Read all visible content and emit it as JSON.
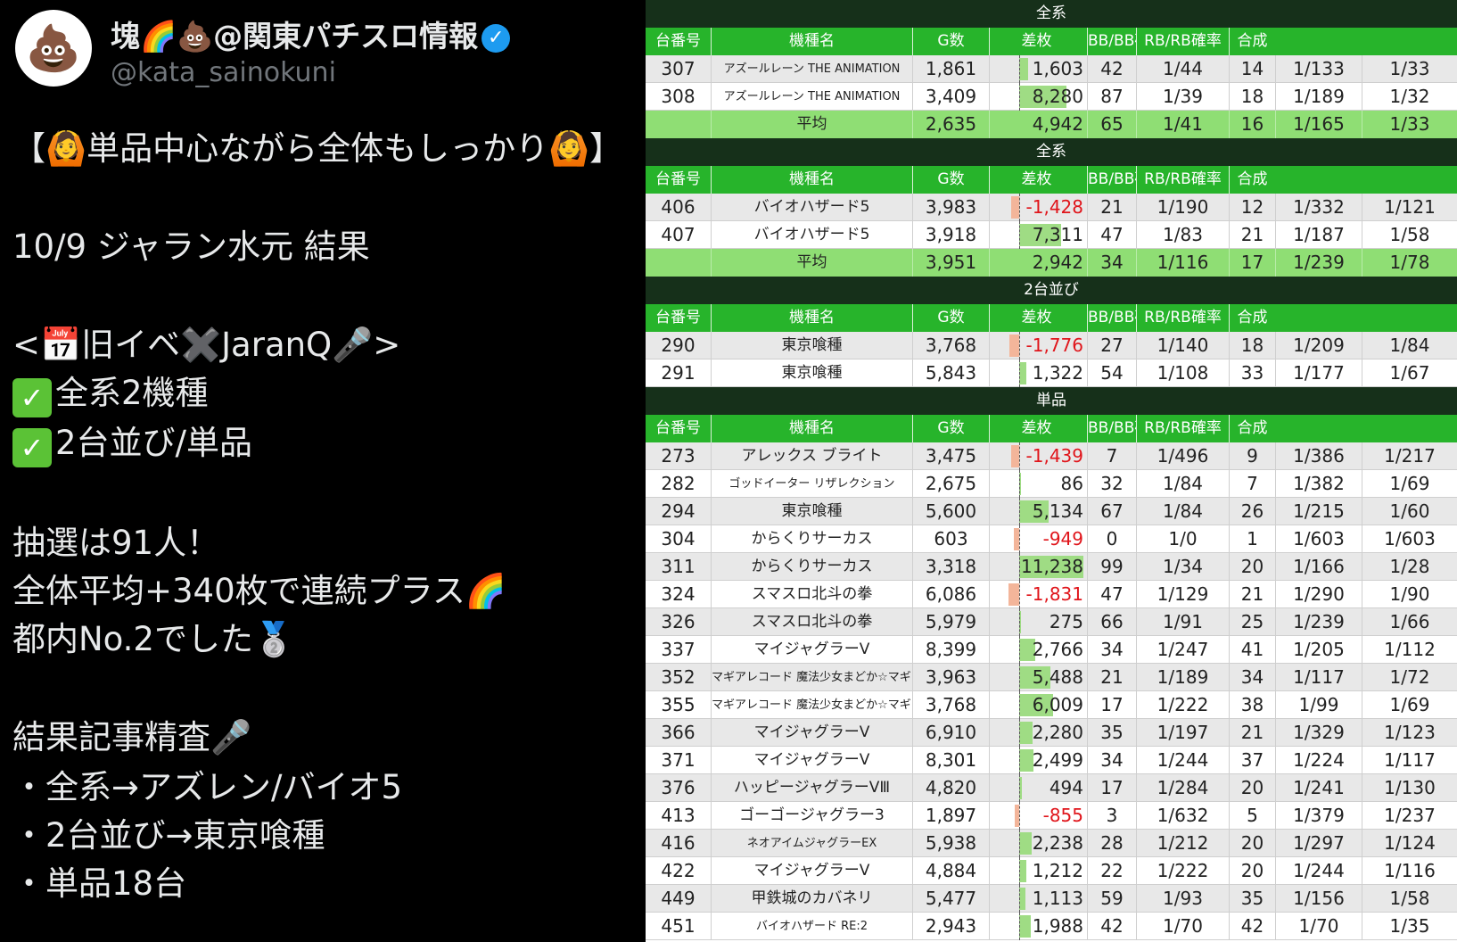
{
  "tweet": {
    "display_name": "塊🌈💩@関東パチスロ情報",
    "verified_icon": "verified-badge-icon",
    "handle": "@kata_sainokuni",
    "lines": [
      "【🙆単品中心ながら全体もしっかり🙆】",
      "10/9 ジャラン水元 結果",
      "<📅旧イベ✖️JaranQ🎤>",
      "全系2機種",
      "2台並び/単品",
      "抽選は91人！",
      "全体平均+340枚で連続プラス🌈",
      "都内No.2でした🥈",
      "結果記事精査🎤",
      "・全系→アズレン/バイオ5",
      "・2台並び→東京喰種",
      "・単品18台"
    ],
    "check_icon": "check-mark-icon"
  },
  "table": {
    "headers": [
      "台番号",
      "機種名",
      "G数",
      "差枚",
      "BB/BB確率",
      "RB/RB確率",
      "合成"
    ],
    "colors": {
      "section_bg": "#16301a",
      "header_bg": "#27b42b",
      "avg_bg": "#8fde74",
      "positive_bar": "#9fdc84",
      "negative_bar": "#f3b59a",
      "negative_text": "#e0141a"
    },
    "sections": [
      {
        "title": "全系",
        "rows": [
          {
            "no": "307",
            "name": "アズールレーン THE ANIMATION",
            "g": "1,861",
            "diff": "1,603",
            "diffv": 1603,
            "bb": "42",
            "bbp": "1/44",
            "rb": "14",
            "rbp": "1/133",
            "total": "1/33"
          },
          {
            "no": "308",
            "name": "アズールレーン THE ANIMATION",
            "g": "3,409",
            "diff": "8,280",
            "diffv": 8280,
            "bb": "87",
            "bbp": "1/39",
            "rb": "18",
            "rbp": "1/189",
            "total": "1/32"
          }
        ],
        "avg": {
          "label": "平均",
          "g": "2,635",
          "diff": "4,942",
          "bb": "65",
          "bbp": "1/41",
          "rb": "16",
          "rbp": "1/165",
          "total": "1/33"
        }
      },
      {
        "title": "全系",
        "rows": [
          {
            "no": "406",
            "name": "バイオハザード5",
            "g": "3,983",
            "diff": "-1,428",
            "diffv": -1428,
            "bb": "21",
            "bbp": "1/190",
            "rb": "12",
            "rbp": "1/332",
            "total": "1/121"
          },
          {
            "no": "407",
            "name": "バイオハザード5",
            "g": "3,918",
            "diff": "7,311",
            "diffv": 7311,
            "bb": "47",
            "bbp": "1/83",
            "rb": "21",
            "rbp": "1/187",
            "total": "1/58"
          }
        ],
        "avg": {
          "label": "平均",
          "g": "3,951",
          "diff": "2,942",
          "bb": "34",
          "bbp": "1/116",
          "rb": "17",
          "rbp": "1/239",
          "total": "1/78"
        }
      },
      {
        "title": "2台並び",
        "rows": [
          {
            "no": "290",
            "name": "東京喰種",
            "g": "3,768",
            "diff": "-1,776",
            "diffv": -1776,
            "bb": "27",
            "bbp": "1/140",
            "rb": "18",
            "rbp": "1/209",
            "total": "1/84"
          },
          {
            "no": "291",
            "name": "東京喰種",
            "g": "5,843",
            "diff": "1,322",
            "diffv": 1322,
            "bb": "54",
            "bbp": "1/108",
            "rb": "33",
            "rbp": "1/177",
            "total": "1/67"
          }
        ]
      },
      {
        "title": "単品",
        "rows": [
          {
            "no": "273",
            "name": "アレックス ブライト",
            "g": "3,475",
            "diff": "-1,439",
            "diffv": -1439,
            "bb": "7",
            "bbp": "1/496",
            "rb": "9",
            "rbp": "1/386",
            "total": "1/217"
          },
          {
            "no": "282",
            "name": "ゴッドイーター リザレクション",
            "g": "2,675",
            "diff": "86",
            "diffv": 86,
            "bb": "32",
            "bbp": "1/84",
            "rb": "7",
            "rbp": "1/382",
            "total": "1/69"
          },
          {
            "no": "294",
            "name": "東京喰種",
            "g": "5,600",
            "diff": "5,134",
            "diffv": 5134,
            "bb": "67",
            "bbp": "1/84",
            "rb": "26",
            "rbp": "1/215",
            "total": "1/60"
          },
          {
            "no": "304",
            "name": "からくりサーカス",
            "g": "603",
            "diff": "-949",
            "diffv": -949,
            "bb": "0",
            "bbp": "1/0",
            "rb": "1",
            "rbp": "1/603",
            "total": "1/603"
          },
          {
            "no": "311",
            "name": "からくりサーカス",
            "g": "3,318",
            "diff": "11,238",
            "diffv": 11238,
            "bb": "99",
            "bbp": "1/34",
            "rb": "20",
            "rbp": "1/166",
            "total": "1/28"
          },
          {
            "no": "324",
            "name": "スマスロ北斗の拳",
            "g": "6,086",
            "diff": "-1,831",
            "diffv": -1831,
            "bb": "47",
            "bbp": "1/129",
            "rb": "21",
            "rbp": "1/290",
            "total": "1/90"
          },
          {
            "no": "326",
            "name": "スマスロ北斗の拳",
            "g": "5,979",
            "diff": "275",
            "diffv": 275,
            "bb": "66",
            "bbp": "1/91",
            "rb": "25",
            "rbp": "1/239",
            "total": "1/66"
          },
          {
            "no": "337",
            "name": "マイジャグラーV",
            "g": "8,399",
            "diff": "2,766",
            "diffv": 2766,
            "bb": "34",
            "bbp": "1/247",
            "rb": "41",
            "rbp": "1/205",
            "total": "1/112"
          },
          {
            "no": "352",
            "name": "マギアレコード 魔法少女まどか☆マギカ外伝",
            "g": "3,963",
            "diff": "5,488",
            "diffv": 5488,
            "bb": "21",
            "bbp": "1/189",
            "rb": "34",
            "rbp": "1/117",
            "total": "1/72"
          },
          {
            "no": "355",
            "name": "マギアレコード 魔法少女まどか☆マギカ外伝",
            "g": "3,768",
            "diff": "6,009",
            "diffv": 6009,
            "bb": "17",
            "bbp": "1/222",
            "rb": "38",
            "rbp": "1/99",
            "total": "1/69"
          },
          {
            "no": "366",
            "name": "マイジャグラーV",
            "g": "6,910",
            "diff": "2,280",
            "diffv": 2280,
            "bb": "35",
            "bbp": "1/197",
            "rb": "21",
            "rbp": "1/329",
            "total": "1/123"
          },
          {
            "no": "371",
            "name": "マイジャグラーV",
            "g": "8,301",
            "diff": "2,499",
            "diffv": 2499,
            "bb": "34",
            "bbp": "1/244",
            "rb": "37",
            "rbp": "1/224",
            "total": "1/117"
          },
          {
            "no": "376",
            "name": "ハッピージャグラーVⅢ",
            "g": "4,820",
            "diff": "494",
            "diffv": 494,
            "bb": "17",
            "bbp": "1/284",
            "rb": "20",
            "rbp": "1/241",
            "total": "1/130"
          },
          {
            "no": "413",
            "name": "ゴーゴージャグラー3",
            "g": "1,897",
            "diff": "-855",
            "diffv": -855,
            "bb": "3",
            "bbp": "1/632",
            "rb": "5",
            "rbp": "1/379",
            "total": "1/237"
          },
          {
            "no": "416",
            "name": "ネオアイムジャグラーEX",
            "g": "5,938",
            "diff": "2,238",
            "diffv": 2238,
            "bb": "28",
            "bbp": "1/212",
            "rb": "20",
            "rbp": "1/297",
            "total": "1/124"
          },
          {
            "no": "422",
            "name": "マイジャグラーV",
            "g": "4,884",
            "diff": "1,212",
            "diffv": 1212,
            "bb": "22",
            "bbp": "1/222",
            "rb": "20",
            "rbp": "1/244",
            "total": "1/116"
          },
          {
            "no": "449",
            "name": "甲鉄城のカバネリ",
            "g": "5,477",
            "diff": "1,113",
            "diffv": 1113,
            "bb": "59",
            "bbp": "1/93",
            "rb": "35",
            "rbp": "1/156",
            "total": "1/58"
          },
          {
            "no": "451",
            "name": "バイオハザード RE:2",
            "g": "2,943",
            "diff": "1,988",
            "diffv": 1988,
            "bb": "42",
            "bbp": "1/70",
            "rb": "42",
            "rbp": "1/70",
            "total": "1/35"
          }
        ]
      }
    ]
  }
}
